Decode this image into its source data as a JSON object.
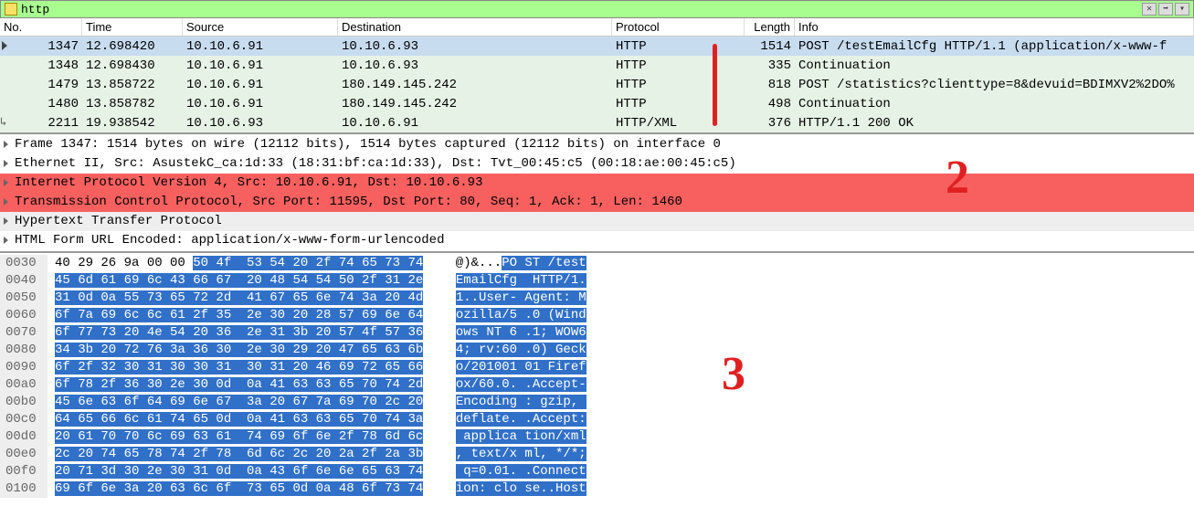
{
  "filter": {
    "text": "http"
  },
  "columns": {
    "no": "No.",
    "time": "Time",
    "src": "Source",
    "dst": "Destination",
    "proto": "Protocol",
    "len": "Length",
    "info": "Info"
  },
  "packets": [
    {
      "no": "1347",
      "time": "12.698420",
      "src": "10.10.6.91",
      "dst": "10.10.6.93",
      "proto": "HTTP",
      "len": "1514",
      "info": "POST /testEmailCfg HTTP/1.1  (application/x-www-f",
      "selected": true
    },
    {
      "no": "1348",
      "time": "12.698430",
      "src": "10.10.6.91",
      "dst": "10.10.6.93",
      "proto": "HTTP",
      "len": "335",
      "info": "Continuation"
    },
    {
      "no": "1479",
      "time": "13.858722",
      "src": "10.10.6.91",
      "dst": "180.149.145.242",
      "proto": "HTTP",
      "len": "818",
      "info": "POST /statistics?clienttype=8&devuid=BDIMXV2%2DO%"
    },
    {
      "no": "1480",
      "time": "13.858782",
      "src": "10.10.6.91",
      "dst": "180.149.145.242",
      "proto": "HTTP",
      "len": "498",
      "info": "Continuation"
    },
    {
      "no": "2211",
      "time": "19.938542",
      "src": "10.10.6.93",
      "dst": "10.10.6.91",
      "proto": "HTTP/XML",
      "len": "376",
      "info": "HTTP/1.1 200 OK"
    }
  ],
  "details": [
    {
      "text": "Frame 1347: 1514 bytes on wire (12112 bits), 1514 bytes captured (12112 bits) on interface 0",
      "cls": ""
    },
    {
      "text": "Ethernet II, Src: AsustekC_ca:1d:33 (18:31:bf:ca:1d:33), Dst: Tvt_00:45:c5 (00:18:ae:00:45:c5)",
      "cls": ""
    },
    {
      "text": "Internet Protocol Version 4, Src: 10.10.6.91, Dst: 10.10.6.93",
      "cls": "red"
    },
    {
      "text": "Transmission Control Protocol, Src Port: 11595, Dst Port: 80, Seq: 1, Ack: 1, Len: 1460",
      "cls": "red"
    },
    {
      "text": "Hypertext Transfer Protocol",
      "cls": "grey"
    },
    {
      "text": "HTML Form URL Encoded: application/x-www-form-urlencoded",
      "cls": ""
    }
  ],
  "hex": [
    {
      "off": "0030",
      "b1": "40 29 26 9a 00 00 ",
      "b2": "50 4f  53 54 20 2f 74 65 73 74",
      "a1": "  @)&...",
      "a2": "PO ST /test"
    },
    {
      "off": "0040",
      "b1": "",
      "b2": "45 6d 61 69 6c 43 66 67  20 48 54 54 50 2f 31 2e",
      "a1": "  ",
      "a2": "EmailCfg  HTTP/1."
    },
    {
      "off": "0050",
      "b1": "",
      "b2": "31 0d 0a 55 73 65 72 2d  41 67 65 6e 74 3a 20 4d",
      "a1": "  ",
      "a2": "1..User- Agent: M"
    },
    {
      "off": "0060",
      "b1": "",
      "b2": "6f 7a 69 6c 6c 61 2f 35  2e 30 20 28 57 69 6e 64",
      "a1": "  ",
      "a2": "ozilla/5 .0 (Wind"
    },
    {
      "off": "0070",
      "b1": "",
      "b2": "6f 77 73 20 4e 54 20 36  2e 31 3b 20 57 4f 57 36",
      "a1": "  ",
      "a2": "ows NT 6 .1; WOW6"
    },
    {
      "off": "0080",
      "b1": "",
      "b2": "34 3b 20 72 76 3a 36 30  2e 30 29 20 47 65 63 6b",
      "a1": "  ",
      "a2": "4; rv:60 .0) Geck"
    },
    {
      "off": "0090",
      "b1": "",
      "b2": "6f 2f 32 30 31 30 30 31  30 31 20 46 69 72 65 66",
      "a1": "  ",
      "a2": "o/201001 01 Firef"
    },
    {
      "off": "00a0",
      "b1": "",
      "b2": "6f 78 2f 36 30 2e 30 0d  0a 41 63 63 65 70 74 2d",
      "a1": "  ",
      "a2": "ox/60.0. .Accept-"
    },
    {
      "off": "00b0",
      "b1": "",
      "b2": "45 6e 63 6f 64 69 6e 67  3a 20 67 7a 69 70 2c 20",
      "a1": "  ",
      "a2": "Encoding : gzip, "
    },
    {
      "off": "00c0",
      "b1": "",
      "b2": "64 65 66 6c 61 74 65 0d  0a 41 63 63 65 70 74 3a",
      "a1": "  ",
      "a2": "deflate. .Accept:"
    },
    {
      "off": "00d0",
      "b1": "",
      "b2": "20 61 70 70 6c 69 63 61  74 69 6f 6e 2f 78 6d 6c",
      "a1": "  ",
      "a2": " applica tion/xml"
    },
    {
      "off": "00e0",
      "b1": "",
      "b2": "2c 20 74 65 78 74 2f 78  6d 6c 2c 20 2a 2f 2a 3b",
      "a1": "  ",
      "a2": ", text/x ml, */*;"
    },
    {
      "off": "00f0",
      "b1": "",
      "b2": "20 71 3d 30 2e 30 31 0d  0a 43 6f 6e 6e 65 63 74",
      "a1": "  ",
      "a2": " q=0.01. .Connect"
    },
    {
      "off": "0100",
      "b1": "",
      "b2": "69 6f 6e 3a 20 63 6c 6f  73 65 0d 0a 48 6f 73 74",
      "a1": "  ",
      "a2": "ion: clo se..Host"
    }
  ],
  "annotations": {
    "one": "1",
    "two": "2",
    "three": "3"
  },
  "buttons": {
    "clear": "✕",
    "apply": "➡",
    "dropdown": "▾"
  }
}
